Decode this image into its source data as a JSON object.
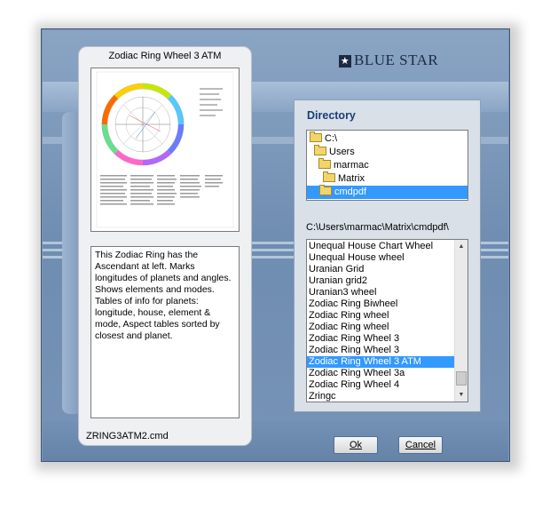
{
  "preview": {
    "title": "Zodiac Ring Wheel 3 ATM",
    "description": "This Zodiac Ring has the Ascendant at left. Marks longitudes of planets and angles. Shows elements and modes. Tables of info for planets: longitude, house, element & mode, Aspect tables sorted by closest and planet.",
    "filename": "ZRING3ATM2.cmd"
  },
  "logo": {
    "text": "BLUE STAR",
    "star": "★"
  },
  "directory": {
    "heading": "Directory",
    "tree": [
      "C:\\",
      "Users",
      "marmac",
      "Matrix",
      "cmdpdf"
    ],
    "tree_selected": "cmdpdf",
    "path": "C:\\Users\\marmac\\Matrix\\cmdpdf\\",
    "files": [
      "Unequal House Chart Wheel",
      "Unequal House wheel",
      "Uranian Grid",
      "Uranian grid2",
      "Uranian3 wheel",
      "Zodiac Ring Biwheel",
      "Zodiac Ring wheel",
      "Zodiac Ring wheel",
      "Zodiac Ring Wheel 3",
      "Zodiac Ring Wheel 3",
      "Zodiac Ring Wheel 3 ATM",
      "Zodiac Ring Wheel 3a",
      "Zodiac Ring Wheel 4",
      "Zringc"
    ],
    "selected_file": "Zodiac Ring Wheel 3 ATM"
  },
  "buttons": {
    "ok": "Ok",
    "cancel": "Cancel"
  },
  "colors": {
    "accent": "#3399ff",
    "heading": "#1a3e78",
    "frame": "#7b97b8"
  }
}
